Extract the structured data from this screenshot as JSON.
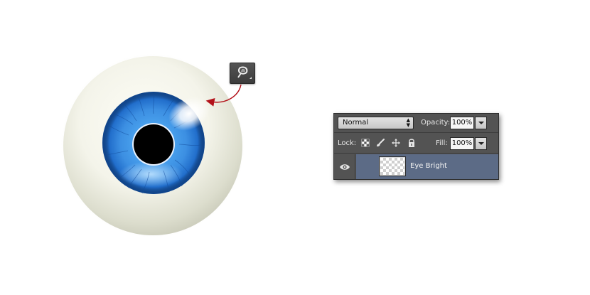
{
  "canvas": {
    "background": "#ffffff",
    "illustration": "eyeball",
    "sclera_color": "#f3f3ea",
    "iris_color": "#2f7fd6",
    "pupil_color": "#000000",
    "highlight": "eye-bright-glow",
    "annotation_arrow_color": "#b3121a"
  },
  "tool_tile": {
    "icon": "dodge-tool-icon"
  },
  "layers_panel": {
    "blend_mode": "Normal",
    "opacity_label": "Opacity:",
    "opacity_value": "100%",
    "lock_label": "Lock:",
    "lock_icons": [
      "lock-transparent-pixels-icon",
      "lock-image-pixels-icon",
      "lock-position-icon",
      "lock-all-icon"
    ],
    "fill_label": "Fill:",
    "fill_value": "100%",
    "layer": {
      "name": "Eye Bright",
      "visible": true,
      "selected": true,
      "visibility_icon": "eye-icon",
      "thumbnail": "transparent-checkerboard"
    },
    "colors": {
      "panel_bg": "#535353",
      "selected_row": "#5c6b86"
    }
  }
}
